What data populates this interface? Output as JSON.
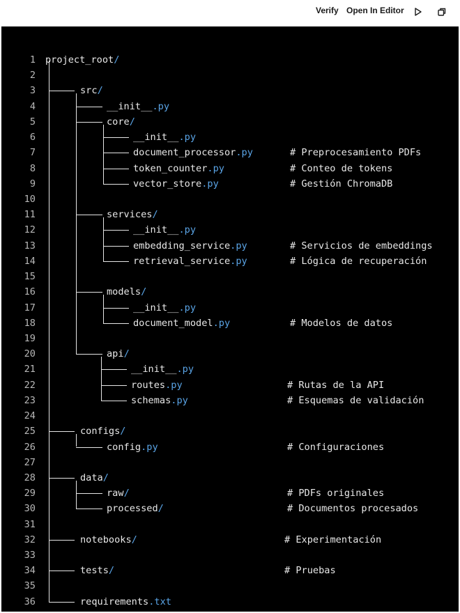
{
  "toolbar": {
    "verify_label": "Verify",
    "open_editor_label": "Open In Editor",
    "run_icon": "play-icon",
    "copy_icon": "copy-icon"
  },
  "colors": {
    "background": "#000000",
    "text": "#e8e8e8",
    "line_number": "#b8b8b8",
    "extension": "#5aa4e6",
    "highlight": "#f0c040"
  },
  "lines": [
    {
      "n": "1",
      "name": "project_root",
      "suffix": "/",
      "comment": ""
    },
    {
      "n": "2",
      "name": "",
      "suffix": "",
      "comment": ""
    },
    {
      "n": "3",
      "name": "src",
      "suffix": "/",
      "comment": ""
    },
    {
      "n": "4",
      "name": "__init__",
      "suffix": ".py",
      "comment": ""
    },
    {
      "n": "5",
      "name": "core",
      "suffix": "/",
      "comment": ""
    },
    {
      "n": "6",
      "name": "__init__",
      "suffix": ".py",
      "comment": ""
    },
    {
      "n": "7",
      "name": "document_processor",
      "suffix": ".py",
      "comment": "# Preprocesamiento PDFs"
    },
    {
      "n": "8",
      "name": "token_counter",
      "suffix": ".py",
      "comment": "# Conteo de tokens"
    },
    {
      "n": "9",
      "name": "vector_store",
      "suffix": ".py",
      "comment": "# Gestión ChromaDB"
    },
    {
      "n": "10",
      "name": "",
      "suffix": "",
      "comment": ""
    },
    {
      "n": "11",
      "name": "services",
      "suffix": "/",
      "comment": ""
    },
    {
      "n": "12",
      "name": "__init__",
      "suffix": ".py",
      "comment": ""
    },
    {
      "n": "13",
      "name": "embedding_service",
      "suffix": ".py",
      "comment": "# Servicios de embeddings"
    },
    {
      "n": "14",
      "name": "retrieval_service",
      "suffix": ".py",
      "comment": "# Lógica de recuperación"
    },
    {
      "n": "15",
      "name": "",
      "suffix": "",
      "comment": ""
    },
    {
      "n": "16",
      "name": "models",
      "suffix": "/",
      "comment": ""
    },
    {
      "n": "17",
      "name": "__init__",
      "suffix": ".py",
      "comment": ""
    },
    {
      "n": "18",
      "name": "document_model",
      "suffix": ".py",
      "comment": "# Modelos de datos"
    },
    {
      "n": "19",
      "name": "",
      "suffix": "",
      "comment": ""
    },
    {
      "n": "20",
      "name": "api",
      "suffix": "/",
      "comment": ""
    },
    {
      "n": "21",
      "name": "__init__",
      "suffix": ".py",
      "comment": ""
    },
    {
      "n": "22",
      "name": "routes",
      "suffix": ".py",
      "comment": "# Rutas de la ",
      "comment_hl": "API"
    },
    {
      "n": "23",
      "name": "schemas",
      "suffix": ".py",
      "comment": "# Esquemas de validación"
    },
    {
      "n": "24",
      "name": "",
      "suffix": "",
      "comment": ""
    },
    {
      "n": "25",
      "name": "configs",
      "suffix": "/",
      "comment": ""
    },
    {
      "n": "26",
      "name": "config",
      "suffix": ".py",
      "comment": "# Configuraciones"
    },
    {
      "n": "27",
      "name": "",
      "suffix": "",
      "comment": ""
    },
    {
      "n": "28",
      "name": "data",
      "suffix": "/",
      "comment": ""
    },
    {
      "n": "29",
      "name": "raw",
      "suffix": "/",
      "comment": "# PDFs originales"
    },
    {
      "n": "30",
      "name": "processed",
      "suffix": "/",
      "comment": "# Documentos procesados"
    },
    {
      "n": "31",
      "name": "",
      "suffix": "",
      "comment": ""
    },
    {
      "n": "32",
      "name": "notebooks",
      "suffix": "/",
      "comment": "# Experimentación"
    },
    {
      "n": "33",
      "name": "",
      "suffix": "",
      "comment": ""
    },
    {
      "n": "34",
      "name": "tests",
      "suffix": "/",
      "comment": "# Pruebas"
    },
    {
      "n": "35",
      "name": "",
      "suffix": "",
      "comment": ""
    },
    {
      "n": "36",
      "name": "requirements",
      "suffix": ".txt",
      "comment": ""
    }
  ]
}
